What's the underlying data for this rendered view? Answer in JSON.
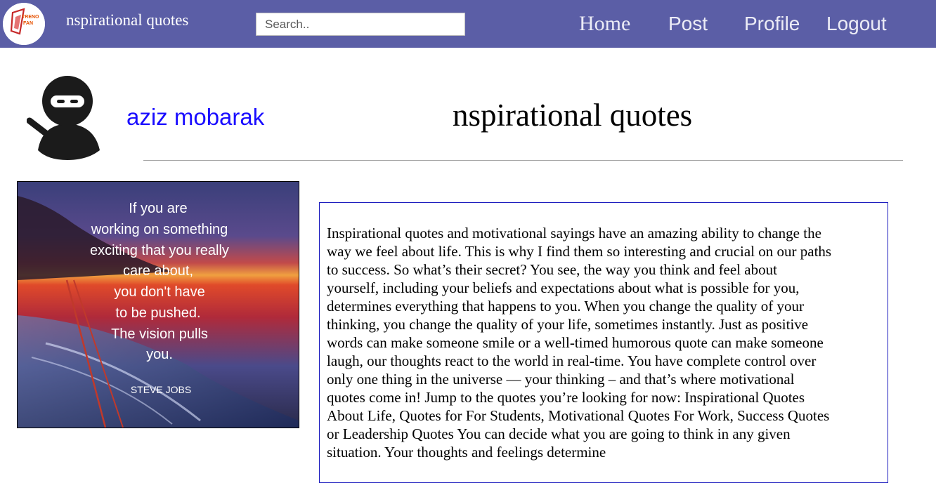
{
  "header": {
    "logo_text_top": "TRENO",
    "logo_text_bottom": "FAN",
    "site_title": "nspirational quotes",
    "search": {
      "placeholder": "Search..",
      "value": ""
    },
    "nav": {
      "home": "Home",
      "post": "Post",
      "profile": "Profile",
      "logout": "Logout"
    }
  },
  "profile": {
    "username": "aziz mobarak",
    "page_title": "nspirational quotes"
  },
  "quote_image": {
    "lines": [
      "If you are",
      "working on something",
      "exciting that you really",
      "care about,",
      "you don't have",
      "to be pushed.",
      "The vision pulls",
      "you."
    ],
    "author": "STEVE JOBS"
  },
  "post": {
    "body": "Inspirational quotes and motivational sayings have an amazing ability to change the way we feel about life. This is why I find them so interesting and crucial on our paths to success. So what’s their secret? You see, the way you think and feel about yourself, including your beliefs and expectations about what is possible for you, determines everything that happens to you. When you change the quality of your thinking, you change the quality of your life, sometimes instantly. Just as positive words can make someone smile or a well-timed humorous quote can make someone laugh, our thoughts react to the world in real-time. You have complete control over only one thing in the universe — your thinking – and that’s where motivational quotes come in! Jump to the quotes you’re looking for now: Inspirational Quotes About Life, Quotes for For Students, Motivational Quotes For Work, Success Quotes or Leadership Quotes You can decide what you are going to think in any given situation. Your thoughts and feelings determine"
  },
  "colors": {
    "navbar": "#5b5ea6",
    "username_link": "#1a0dff",
    "content_border": "#1c1cbe"
  },
  "icons": {
    "logo": "site-logo-icon",
    "avatar": "ninja-avatar-icon"
  }
}
